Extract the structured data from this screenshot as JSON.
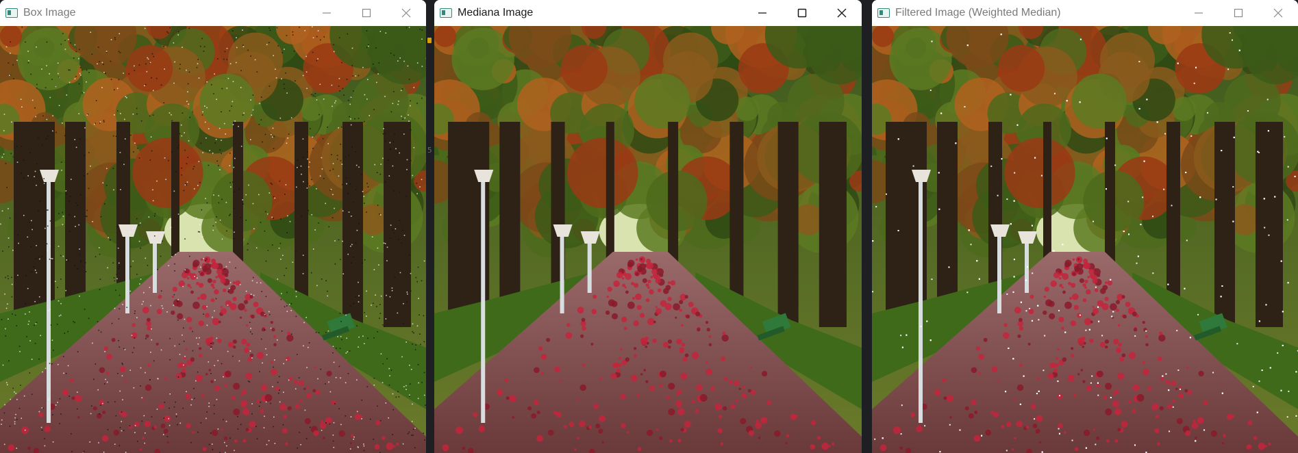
{
  "windows": [
    {
      "title": "Box Image",
      "active": false,
      "noise": "speckle"
    },
    {
      "title": "Mediana Image",
      "active": true,
      "noise": "none"
    },
    {
      "title": "Filtered Image (Weighted Median)",
      "active": false,
      "noise": "white-dots"
    }
  ],
  "controls": {
    "minimize_icon": "minimize-icon",
    "maximize_icon": "maximize-icon",
    "close_icon": "close-icon"
  },
  "scene": "autumn park avenue with red leaf-covered path, lamp posts, hedges and green bench",
  "gap_digit": "5"
}
